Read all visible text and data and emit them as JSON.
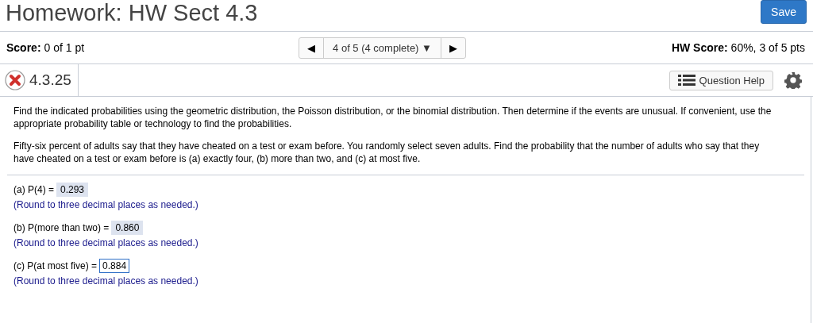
{
  "header": {
    "title": "Homework: HW Sect 4.3",
    "save_button": "Save"
  },
  "score_bar": {
    "score_label": "Score:",
    "score_value": "0 of 1 pt",
    "nav": {
      "prev": "◀",
      "position": "4 of 5 (4 complete)",
      "dropdown": "▼",
      "next": "▶"
    },
    "hw_score_label": "HW Score:",
    "hw_score_value": "60%, 3 of 5 pts"
  },
  "question_bar": {
    "correct": false,
    "number": "4.3.25",
    "help_button": "Question Help"
  },
  "question": {
    "instructions": "Find the indicated probabilities using the geometric distribution, the Poisson distribution, or the binomial distribution. Then determine if the events are unusual. If convenient, use the appropriate probability table or technology to find the probabilities.",
    "problem": "Fifty-six percent of adults say that they have cheated on a test or exam before. You randomly select seven adults. Find the probability that the number of adults who say that they have cheated on a test or exam before is (a) exactly four, (b) more than two, and (c) at most five.",
    "parts": [
      {
        "label": "(a) P(4) =",
        "value": "0.293",
        "focused": false,
        "hint": "(Round to three decimal places as needed.)"
      },
      {
        "label": "(b) P(more than two) =",
        "value": "0.860",
        "focused": false,
        "hint": "(Round to three decimal places as needed.)"
      },
      {
        "label": "(c) P(at most five) =",
        "value": "0.884",
        "focused": true,
        "hint": "(Round to three decimal places as needed.)"
      }
    ]
  }
}
